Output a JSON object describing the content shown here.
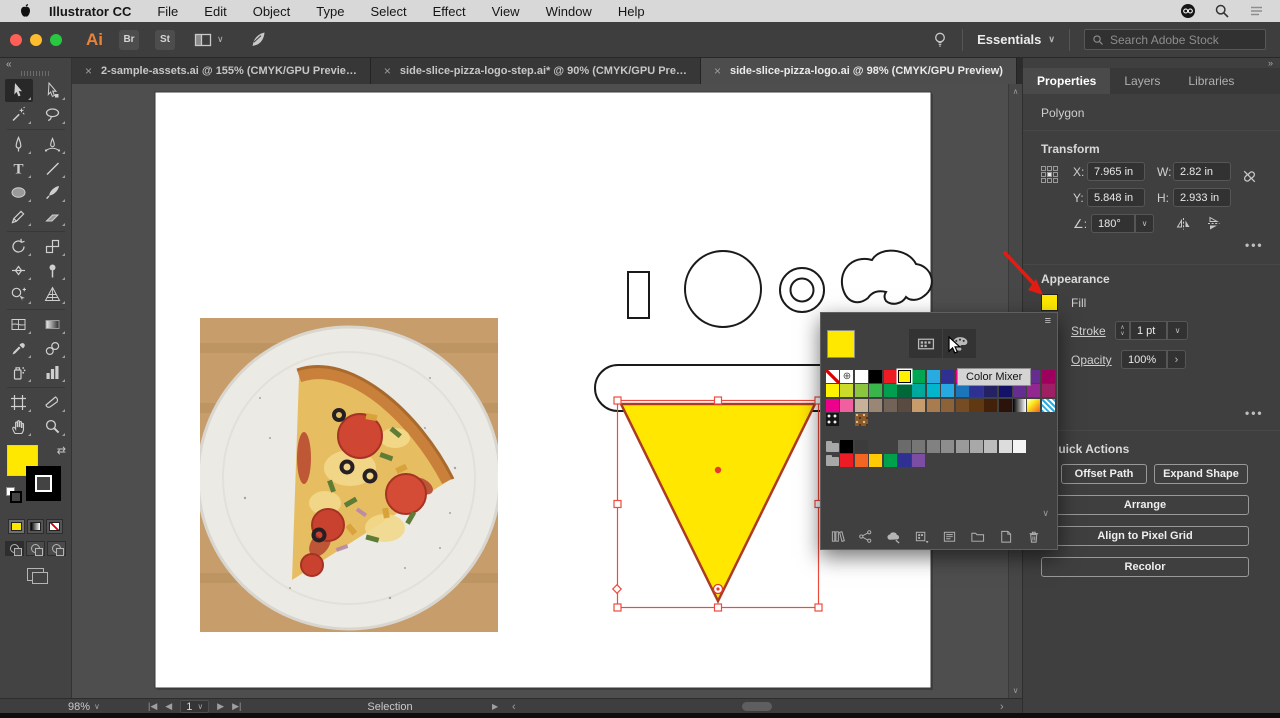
{
  "menubar": {
    "app_name": "Illustrator CC",
    "items": [
      "File",
      "Edit",
      "Object",
      "Type",
      "Select",
      "Effect",
      "View",
      "Window",
      "Help"
    ]
  },
  "appbar": {
    "ai_logo": "Ai",
    "badges": [
      "Br",
      "St"
    ],
    "workspace_label": "Essentials",
    "search_placeholder": "Search Adobe Stock"
  },
  "tabs": [
    {
      "label": "2-sample-assets.ai @ 155% (CMYK/GPU Previe…",
      "active": false
    },
    {
      "label": "side-slice-pizza-logo-step.ai* @ 90% (CMYK/GPU Pre…",
      "active": false
    },
    {
      "label": "side-slice-pizza-logo.ai @ 98% (CMYK/GPU Preview)",
      "active": true
    }
  ],
  "toolpanel": {
    "tools": [
      {
        "id": "selection",
        "active": true
      },
      {
        "id": "direct-selection",
        "active": false
      },
      {
        "id": "magic-wand",
        "active": false
      },
      {
        "id": "lasso",
        "active": false
      },
      {
        "id": "pen",
        "active": false
      },
      {
        "id": "curvature",
        "active": false
      },
      {
        "id": "type",
        "active": false
      },
      {
        "id": "line-segment",
        "active": false
      },
      {
        "id": "ellipse",
        "active": false
      },
      {
        "id": "paintbrush",
        "active": false
      },
      {
        "id": "pencil",
        "active": false
      },
      {
        "id": "eraser",
        "active": false
      },
      {
        "id": "rotate",
        "active": false
      },
      {
        "id": "scale",
        "active": false
      },
      {
        "id": "width",
        "active": false
      },
      {
        "id": "puppet-warp",
        "active": false
      },
      {
        "id": "shape-builder",
        "active": false
      },
      {
        "id": "perspective-grid",
        "active": false
      },
      {
        "id": "mesh",
        "active": false
      },
      {
        "id": "gradient",
        "active": false
      },
      {
        "id": "eyedropper",
        "active": false
      },
      {
        "id": "blend",
        "active": false
      },
      {
        "id": "symbol-sprayer",
        "active": false
      },
      {
        "id": "column-graph",
        "active": false
      },
      {
        "id": "artboard",
        "active": false
      },
      {
        "id": "slice",
        "active": false
      },
      {
        "id": "hand",
        "active": false
      },
      {
        "id": "zoom",
        "active": false
      }
    ],
    "dividers_after": [
      3,
      11,
      17,
      23
    ],
    "fill_color": "#ffe800"
  },
  "properties": {
    "panel_tabs": [
      "Properties",
      "Layers",
      "Libraries"
    ],
    "object_type": "Polygon",
    "transform": {
      "title": "Transform",
      "x_label": "X:",
      "x_value": "7.965 in",
      "y_label": "Y:",
      "y_value": "5.848 in",
      "w_label": "W:",
      "w_value": "2.82 in",
      "h_label": "H:",
      "h_value": "2.933 in",
      "angle_label": "∠:",
      "angle_value": "180°"
    },
    "appearance": {
      "title": "Appearance",
      "fill_label": "Fill",
      "fill_color": "#ffe800",
      "stroke_label": "Stroke",
      "stroke_value": "1 pt",
      "opacity_label": "Opacity",
      "opacity_value": "100%"
    },
    "quick_actions": {
      "title": "Quick Actions",
      "buttons": [
        "Offset Path",
        "Expand Shape",
        "Arrange",
        "Align to Pixel Grid",
        "Recolor"
      ]
    }
  },
  "swatches_popup": {
    "tooltip": "Color Mixer",
    "selected_color": "#fff200",
    "grid": [
      [
        "none",
        "reg",
        "#ffffff",
        "#000000",
        "#ed1c24",
        "sel:#fff200",
        "#00a651",
        "#29abe2",
        "#2e3192",
        "#ec008c",
        "#f7931e",
        "#f15a24",
        "#c1272d",
        "#93278f",
        "#662d91",
        "#9e005d"
      ],
      [
        "#fff200",
        "#cbdb2a",
        "#8cc63f",
        "#3ab54a",
        "#009e4f",
        "#006838",
        "#00a99d",
        "#00b5cc",
        "#27aae1",
        "#1b75bb",
        "#2e3192",
        "#252263",
        "#131168",
        "#652d90",
        "#92278f",
        "#9e1f63"
      ],
      [
        "#ec008c",
        "#f0609e",
        "#c7b299",
        "#998675",
        "#736357",
        "#594a42",
        "#c69c6d",
        "#a97c50",
        "#8c6239",
        "#754c24",
        "#603913",
        "#42210b",
        "#2b130b",
        "gradbw",
        "gradwarm",
        "patcheck"
      ],
      [
        "patdots",
        "patgreen",
        "patbrown"
      ],
      [
        "gap"
      ],
      [
        "folder",
        "#000000",
        "#3c3c3c",
        "blank",
        "blank",
        "#6b6b6b",
        "#767676",
        "#818181",
        "#8d8d8d",
        "#9a9a9a",
        "#a8a8a8",
        "#bcbcbc",
        "#dcdcdc",
        "#f4f4f4"
      ],
      [
        "folder",
        "#ed1c24",
        "#f26522",
        "#ffcb05",
        "#00a14b",
        "#2e3192",
        "#7b4ea3"
      ]
    ],
    "footer_icons": [
      "libraries",
      "share",
      "styles",
      "kinds",
      "options",
      "new-group",
      "new-swatch",
      "delete"
    ]
  },
  "statusbar": {
    "zoom": "98%",
    "artboard_number": "1",
    "status": "Selection",
    "nav_first": "|◀",
    "nav_prev": "◀",
    "nav_next": "▶",
    "nav_last": "▶|"
  },
  "ui": {
    "close": "×",
    "chev_down": "∨",
    "chev_up": "∧",
    "collapse": "«",
    "expand": "»",
    "back": "‹",
    "fwd": "›",
    "play": "▶",
    "dots": "•••",
    "swap": "⇄",
    "registration": "⊕",
    "menu": "≡"
  }
}
